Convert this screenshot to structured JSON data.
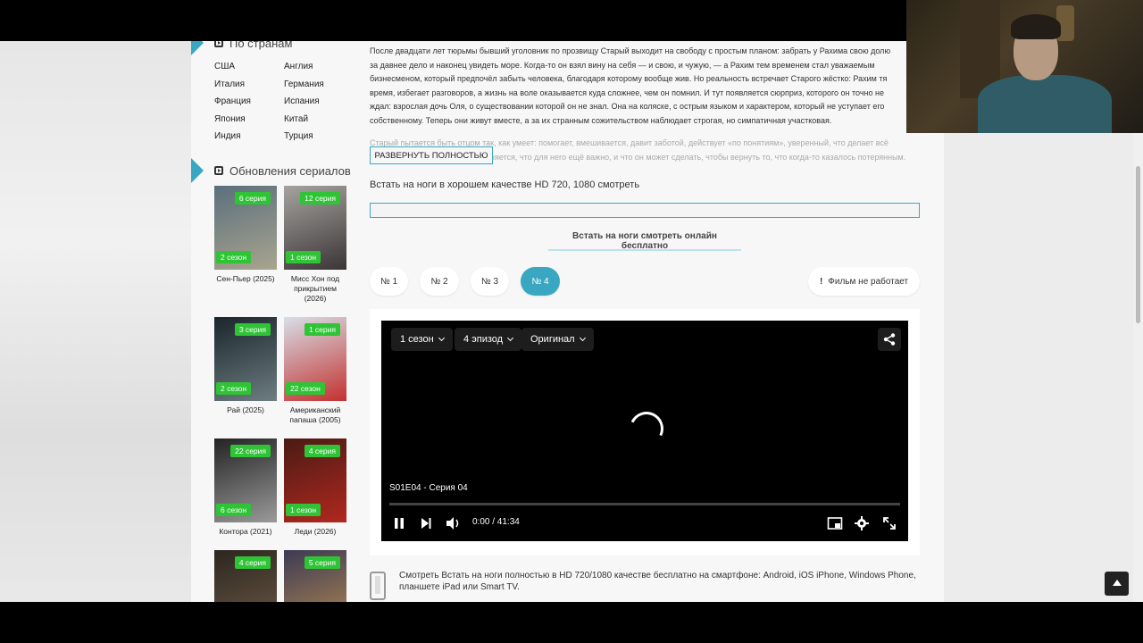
{
  "sidebar": {
    "countries_heading": "По странам",
    "countries": [
      "США",
      "Англия",
      "Италия",
      "Германия",
      "Франция",
      "Испания",
      "Япония",
      "Китай",
      "Индия",
      "Турция"
    ],
    "updates_heading": "Обновления сериалов",
    "series": [
      {
        "title": "Сен-Пьер (2025)",
        "episode": "6 серия",
        "season": "2 сезон",
        "colors": [
          "#5a6f7c",
          "#a9a58f"
        ]
      },
      {
        "title": "Мисс Хон под прикрытием (2026)",
        "episode": "12 серия",
        "season": "1 сезон",
        "colors": [
          "#a5a3a0",
          "#3b3535"
        ]
      },
      {
        "title": "Рай (2025)",
        "episode": "3 серия",
        "season": "2 сезон",
        "colors": [
          "#1a252c",
          "#6d7d80"
        ]
      },
      {
        "title": "Американский папаша (2005)",
        "episode": "1 серия",
        "season": "22 сезон",
        "colors": [
          "#d7dfe8",
          "#c3312f"
        ]
      },
      {
        "title": "Контора (2021)",
        "episode": "22 серия",
        "season": "6 сезон",
        "colors": [
          "#232323",
          "#9a9a9a"
        ]
      },
      {
        "title": "Леди (2026)",
        "episode": "4 серия",
        "season": "1 сезон",
        "colors": [
          "#4a1b14",
          "#b0281f"
        ]
      },
      {
        "title": "",
        "episode": "4 серия",
        "season": "",
        "colors": [
          "#2c2620",
          "#6d5a45"
        ]
      },
      {
        "title": "",
        "episode": "5 серия",
        "season": "",
        "colors": [
          "#3b3a55",
          "#b58950"
        ]
      }
    ]
  },
  "description": {
    "text": "После двадцати лет тюрьмы бывший уголовник по прозвищу Старый выходит на свободу с простым планом: забрать у Рахима свою долю\nза давнее дело и наконец увидеть море. Когда-то он взял вину на себя — и свою, и чужую, — а Рахим тем временем стал уважаемым\nбизнесменом, который предпочёл забыть человека, благодаря которому вообще жив. Но реальность встречает Старого жёстко: Рахим тя\nвремя, избегает разговоров, а жизнь на воле оказывается куда сложнее, чем он помнил. И тут появляется сюрприз, которого он точно не\nждал: взрослая дочь Оля, о существовании которой он не знал. Она на коляске, с острым языком и характером, который не уступает его\nсобственному. Теперь они живут вместе, а за их странным сожительством наблюдает строгая, но симпатичная участковая.",
    "faded_text": "Старый пытается быть отцом так, как умеет: помогает, вмешивается, давит заботой, действует «по понятиям», уверенный, что делает всё\nправильно. Но постепенно выясняется, что для него ещё важно, и что он может сделать, чтобы вернуть то, что когда-то казалось потерянным."
  },
  "expand_label": "РАЗВЕРНУТЬ ПОЛНОСТЬЮ",
  "watch_line": "Встать на ноги в хорошем качестве HD 720, 1080 смотреть",
  "tab_title": "Встать на ноги смотреть онлайн бесплатно",
  "players": [
    "№ 1",
    "№ 2",
    "№ 3",
    "№ 4"
  ],
  "active_player": "№ 4",
  "broken_label": "Фильм не работает",
  "player": {
    "season": "1 сезон",
    "episode": "4 эпизод",
    "audio": "Оригинал",
    "episode_label": "S01E04 - Серия 04",
    "time": "0:00 / 41:34",
    "progress": 0
  },
  "mobile_note": "Смотреть Встать на ноги полностью в HD 720/1080 качестве бесплатно на смартфоне: Android, iOS iPhone, Windows Phone, планшете iPad или Smart TV.",
  "colors": {
    "accent": "#3aa7c2",
    "badge": "#2fc436"
  }
}
